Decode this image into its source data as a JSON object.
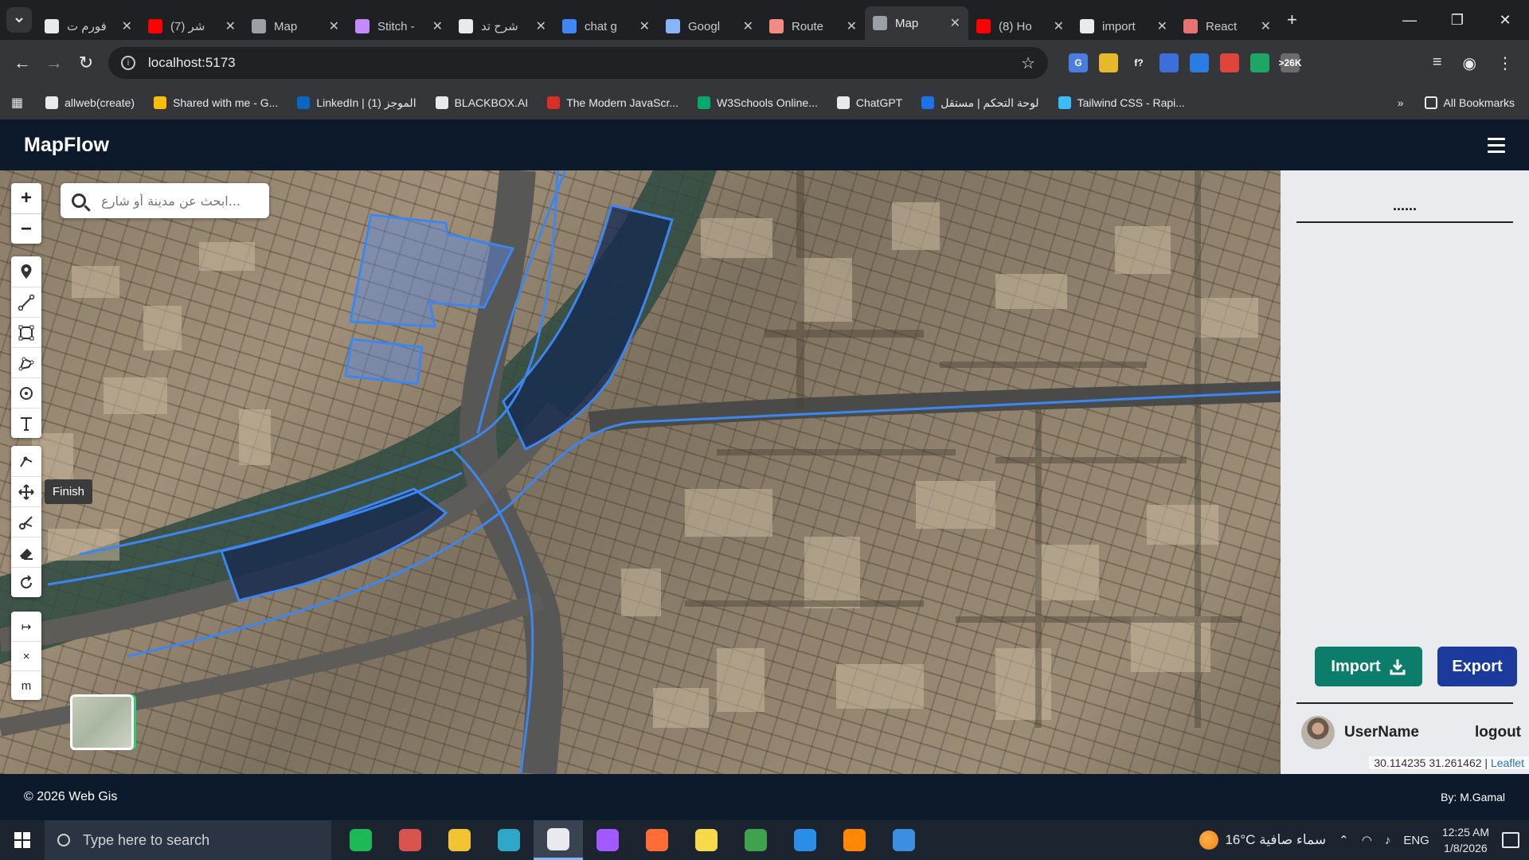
{
  "browser": {
    "tabs": [
      {
        "title": "فورم ت",
        "icon": "chatgpt-icon",
        "color": "#e8eaed",
        "active": false
      },
      {
        "title": "(7) شر",
        "icon": "youtube-icon",
        "color": "#ff0000",
        "active": false
      },
      {
        "title": "Map",
        "icon": "map-icon",
        "color": "#9aa0a6",
        "active": false
      },
      {
        "title": "Stitch -",
        "icon": "stitch-icon",
        "color": "#c58af9",
        "active": false
      },
      {
        "title": "شرح تد",
        "icon": "chatgpt-icon",
        "color": "#e8eaed",
        "active": false
      },
      {
        "title": "chat g",
        "icon": "google-icon",
        "color": "#4285f4",
        "active": false
      },
      {
        "title": "Googl",
        "icon": "gemini-icon",
        "color": "#8ab4f8",
        "active": false
      },
      {
        "title": "Route",
        "icon": "route-icon",
        "color": "#f28b82",
        "active": false
      },
      {
        "title": "Map",
        "icon": "map-icon",
        "color": "#9aa0a6",
        "active": true
      },
      {
        "title": "(8) Ho",
        "icon": "youtube-icon",
        "color": "#ff0000",
        "active": false
      },
      {
        "title": "import",
        "icon": "github-icon",
        "color": "#e8eaed",
        "active": false
      },
      {
        "title": "React",
        "icon": "react-icon",
        "color": "#e57373",
        "active": false
      }
    ],
    "url": "localhost:5173",
    "extensions": [
      {
        "icon": "translate-icon",
        "color": "#4a7de0",
        "text": "G"
      },
      {
        "icon": "folder-ext-icon",
        "color": "#e5b92b",
        "text": ""
      },
      {
        "icon": "formula-icon",
        "color": "#35363a",
        "text": "f?"
      },
      {
        "icon": "grid-ext-icon",
        "color": "#3c6fd8",
        "text": ""
      },
      {
        "icon": "wave-ext-icon",
        "color": "#2a7be4",
        "text": ""
      },
      {
        "icon": "bug-ext-icon",
        "color": "#e0453a",
        "text": ""
      },
      {
        "icon": "color-ext-icon",
        "color": "#1da862",
        "text": ""
      },
      {
        "icon": "counter-ext-icon",
        "color": "#6b6b6b",
        "text": ">26K"
      },
      {
        "icon": "puzzle-icon",
        "color": "#35363a",
        "text": ""
      }
    ],
    "bookmarks": [
      {
        "label": "allweb(create)",
        "icon": "folder-icon",
        "color": "#e8eaed"
      },
      {
        "label": "Shared with me - G...",
        "icon": "drive-icon",
        "color": "#fbbc04"
      },
      {
        "label": "LinkedIn | الموجز (1)",
        "icon": "linkedin-icon",
        "color": "#0a66c2"
      },
      {
        "label": "BLACKBOX.AI",
        "icon": "blackbox-icon",
        "color": "#e8eaed"
      },
      {
        "label": "The Modern JavaScr...",
        "icon": "js-icon",
        "color": "#d93025"
      },
      {
        "label": "W3Schools Online...",
        "icon": "w3-icon",
        "color": "#04aa6d"
      },
      {
        "label": "ChatGPT",
        "icon": "chatgpt-icon",
        "color": "#e8eaed"
      },
      {
        "label": "لوحة التحكم | مستقل",
        "icon": "mostaql-icon",
        "color": "#1a73e8"
      },
      {
        "label": "Tailwind CSS - Rapi...",
        "icon": "tailwind-icon",
        "color": "#38bdf8"
      }
    ],
    "all_bookmarks": "All Bookmarks"
  },
  "app": {
    "brand": "MapFlow",
    "search_placeholder": "...ابحث عن مدينة أو شارع",
    "tooltip": "Finish",
    "units": [
      "↦",
      "×",
      "m"
    ],
    "panel_title": "......",
    "import_label": "Import",
    "export_label": "Export",
    "username": "UserName",
    "logout": "logout",
    "attribution_coords": "30.114235 31.261462 |",
    "attribution_link": "Leaflet",
    "footer_left": "© 2026 Web Gis",
    "footer_right": "By: M.Gamal"
  },
  "taskbar": {
    "search_placeholder": "Type here to search",
    "weather": "16°C  سماء صافية",
    "lang": "ENG",
    "time": "12:25 AM",
    "date": "1/8/2026",
    "apps": [
      {
        "icon": "spotify-icon",
        "color": "#1db954"
      },
      {
        "icon": "app-red-icon",
        "color": "#d9534f"
      },
      {
        "icon": "file-explorer-icon",
        "color": "#f4c430"
      },
      {
        "icon": "edge-icon",
        "color": "#2ea8c7"
      },
      {
        "icon": "chrome-icon",
        "color": "#e8eaed"
      },
      {
        "icon": "figma-icon",
        "color": "#a259ff"
      },
      {
        "icon": "postman-icon",
        "color": "#ff6c37"
      },
      {
        "icon": "sticky-notes-icon",
        "color": "#f7d94c"
      },
      {
        "icon": "mongodb-icon",
        "color": "#3fa34d"
      },
      {
        "icon": "vscode-icon",
        "color": "#2a8ee6"
      },
      {
        "icon": "vlc-icon",
        "color": "#ff8800"
      },
      {
        "icon": "media-player-icon",
        "color": "#3c8fe0"
      }
    ]
  }
}
